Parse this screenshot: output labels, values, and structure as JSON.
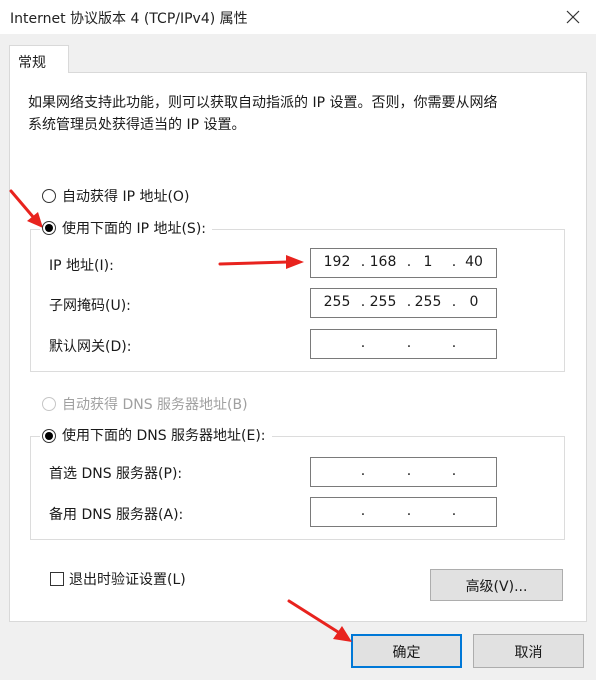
{
  "window": {
    "title": "Internet 协议版本 4 (TCP/IPv4) 属性"
  },
  "tabs": [
    {
      "label": "常规",
      "selected": true
    }
  ],
  "intro_lines": [
    "如果网络支持此功能，则可以获取自动指派的 IP 设置。否则，你需要从网络",
    "系统管理员处获得适当的 IP 设置。"
  ],
  "ip_mode": {
    "auto_label": "自动获得 IP 地址(O)",
    "manual_label": "使用下面的 IP 地址(S):",
    "selected": "manual"
  },
  "ip_fields": {
    "ip_label": "IP 地址(I):",
    "ip_octets": [
      "192",
      "168",
      "1",
      "40"
    ],
    "mask_label": "子网掩码(U):",
    "mask_octets": [
      "255",
      "255",
      "255",
      "0"
    ],
    "gateway_label": "默认网关(D):",
    "gateway_octets": [
      "",
      "",
      "",
      ""
    ]
  },
  "dns_mode": {
    "auto_label": "自动获得 DNS 服务器地址(B)",
    "manual_label": "使用下面的 DNS 服务器地址(E):",
    "selected": "manual"
  },
  "dns_fields": {
    "preferred_label": "首选 DNS 服务器(P):",
    "preferred_octets": [
      "",
      "",
      "",
      ""
    ],
    "alternate_label": "备用 DNS 服务器(A):",
    "alternate_octets": [
      "",
      "",
      "",
      ""
    ]
  },
  "validate": {
    "label": "退出时验证设置(L)",
    "checked": false
  },
  "buttons": {
    "advanced": "高级(V)...",
    "ok": "确定",
    "cancel": "取消"
  },
  "colors": {
    "annotation_arrow": "#e8231e",
    "focus_border": "#0078d7"
  },
  "icons": {
    "close": "close-icon",
    "annotation": "red-arrow-icon"
  }
}
